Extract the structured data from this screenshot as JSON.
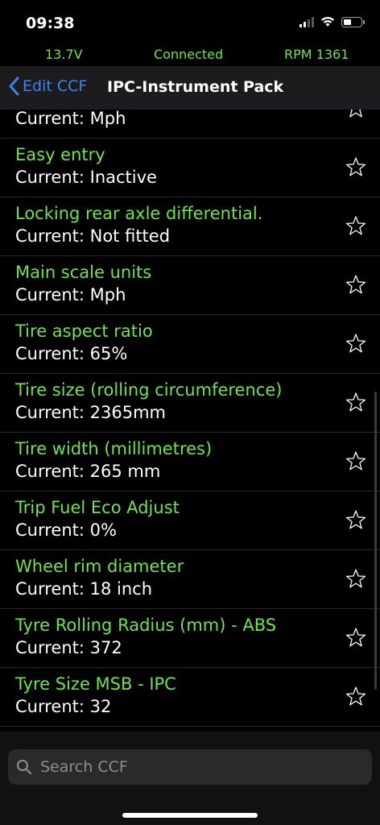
{
  "status": {
    "time": "09:38"
  },
  "info": {
    "voltage": "13.7V",
    "connection": "Connected",
    "rpm": "RPM 1361"
  },
  "nav": {
    "back_label": "Edit CCF",
    "title": "IPC-Instrument Pack"
  },
  "items": [
    {
      "title": "",
      "value": "Current: Mph"
    },
    {
      "title": "Easy entry",
      "value": "Current: Inactive"
    },
    {
      "title": "Locking rear axle differential.",
      "value": "Current: Not fitted"
    },
    {
      "title": "Main scale units",
      "value": "Current: Mph"
    },
    {
      "title": "Tire aspect ratio",
      "value": "Current: 65%"
    },
    {
      "title": "Tire size (rolling circumference)",
      "value": "Current: 2365mm"
    },
    {
      "title": "Tire width (millimetres)",
      "value": "Current: 265 mm"
    },
    {
      "title": "Trip Fuel Eco Adjust",
      "value": "Current: 0%"
    },
    {
      "title": "Wheel rim diameter",
      "value": "Current: 18 inch"
    },
    {
      "title": "Tyre Rolling Radius (mm) - ABS",
      "value": "Current: 372"
    },
    {
      "title": "Tyre Size MSB - IPC",
      "value": "Current: 32"
    }
  ],
  "search": {
    "placeholder": "Search CCF",
    "value": ""
  },
  "icons": {
    "back": "chevron-left-icon",
    "favorite": "star-outline-icon",
    "search": "magnifier-icon"
  },
  "colors": {
    "accent_green": "#6fe44f",
    "link_blue": "#3b82f6",
    "background": "#000000"
  }
}
